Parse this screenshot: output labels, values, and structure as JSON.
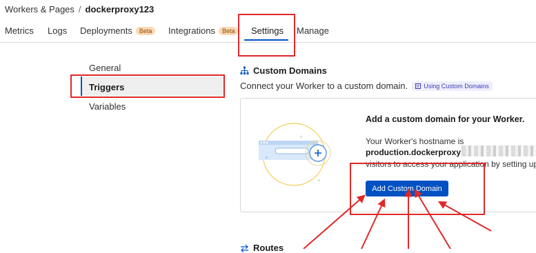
{
  "breadcrumb": {
    "parent": "Workers & Pages",
    "separator": "/",
    "current": "dockerproxy123"
  },
  "tabs": [
    {
      "label": "Metrics"
    },
    {
      "label": "Logs"
    },
    {
      "label": "Deployments",
      "badge": "Beta"
    },
    {
      "label": "Integrations",
      "badge": "Beta"
    },
    {
      "label": "Settings",
      "active": true
    },
    {
      "label": "Manage"
    }
  ],
  "sidebar": {
    "items": [
      {
        "label": "General"
      },
      {
        "label": "Triggers",
        "active": true
      },
      {
        "label": "Variables"
      }
    ]
  },
  "custom_domains": {
    "title": "Custom Domains",
    "description": "Connect your Worker to a custom domain.",
    "doc_link": "Using Custom Domains",
    "card": {
      "heading": "Add a custom domain for your Worker.",
      "line1": "Your Worker's hostname is",
      "hostname": "production.dockerproxy",
      "line3": "visitors to access your application by setting up",
      "button": "Add Custom Domain"
    }
  },
  "routes": {
    "title": "Routes"
  },
  "colors": {
    "accent": "#0051c3",
    "annotation": "#e02828"
  },
  "icons": [
    "sitemap-icon",
    "document-icon",
    "plus-icon",
    "routes-icon"
  ]
}
